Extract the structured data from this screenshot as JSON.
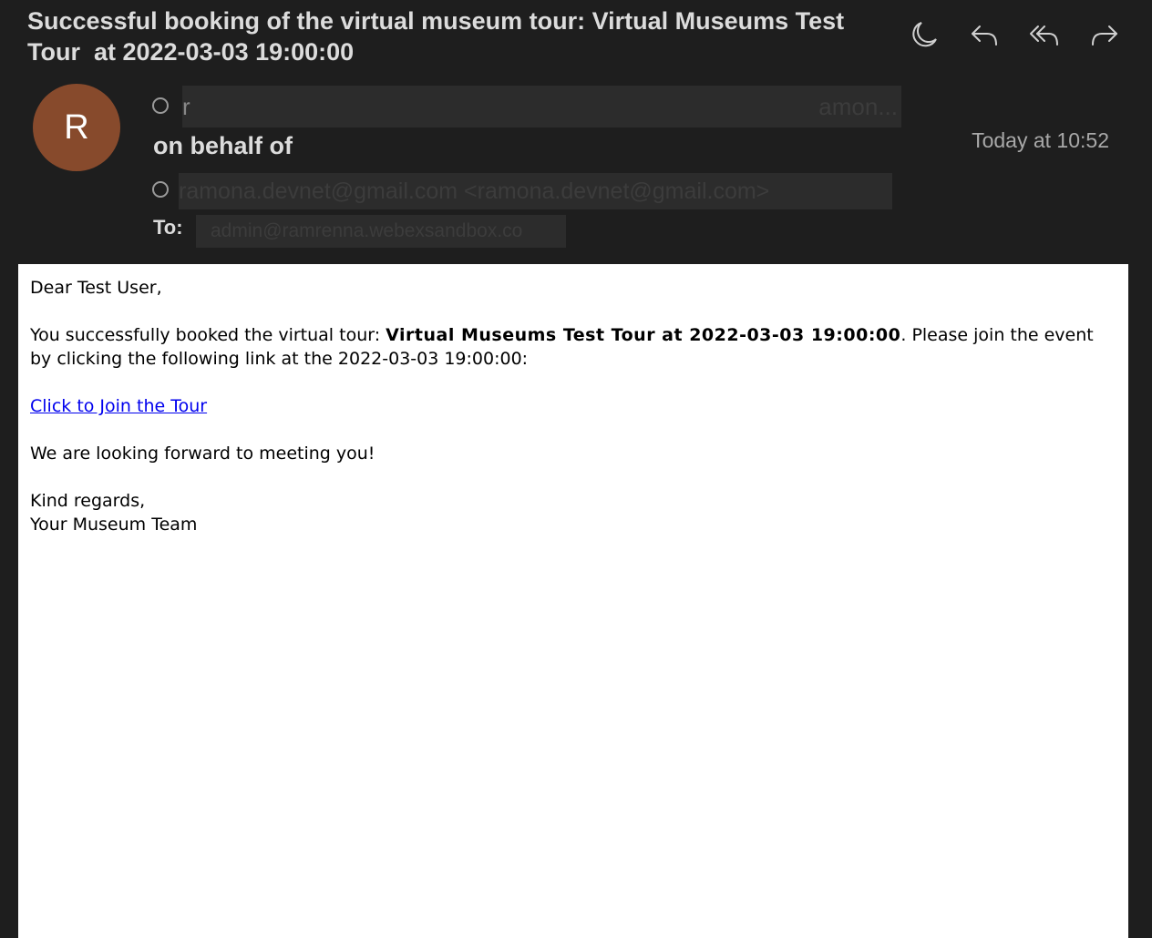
{
  "email": {
    "subject": "Successful booking of the virtual museum tour: Virtual Museums Test Tour  at 2022-03-03 19:00:00",
    "toolbar": {
      "icons": [
        "moon-icon",
        "reply-icon",
        "reply-all-icon",
        "forward-icon"
      ]
    },
    "sender": {
      "avatar_initial": "R",
      "avatar_color": "#874a2c",
      "from_redacted_visible_start": "r",
      "from_redacted_visible_end": "amon...",
      "on_behalf_label": "on behalf of",
      "behalf_address": "ramona.devnet@gmail.com <ramona.devnet@gmail.com>"
    },
    "date": "Today at 10:52",
    "to_label": "To:",
    "to_address": "admin@ramrenna.webexsandbox.co"
  },
  "body": {
    "greeting": "Dear Test User,",
    "para1_prefix": "You successfully booked the virtual tour: ",
    "para1_tour": "Virtual Museums Test Tour at 2022-03-03 19:00:00",
    "para1_suffix": ". Please join the event by clicking the following link at the 2022-03-03 19:00:00:",
    "join_link": "Click to Join the Tour ",
    "closing_line": "We are looking forward to meeting you!",
    "signoff": "Kind regards,",
    "signature": "Your Museum Team"
  }
}
